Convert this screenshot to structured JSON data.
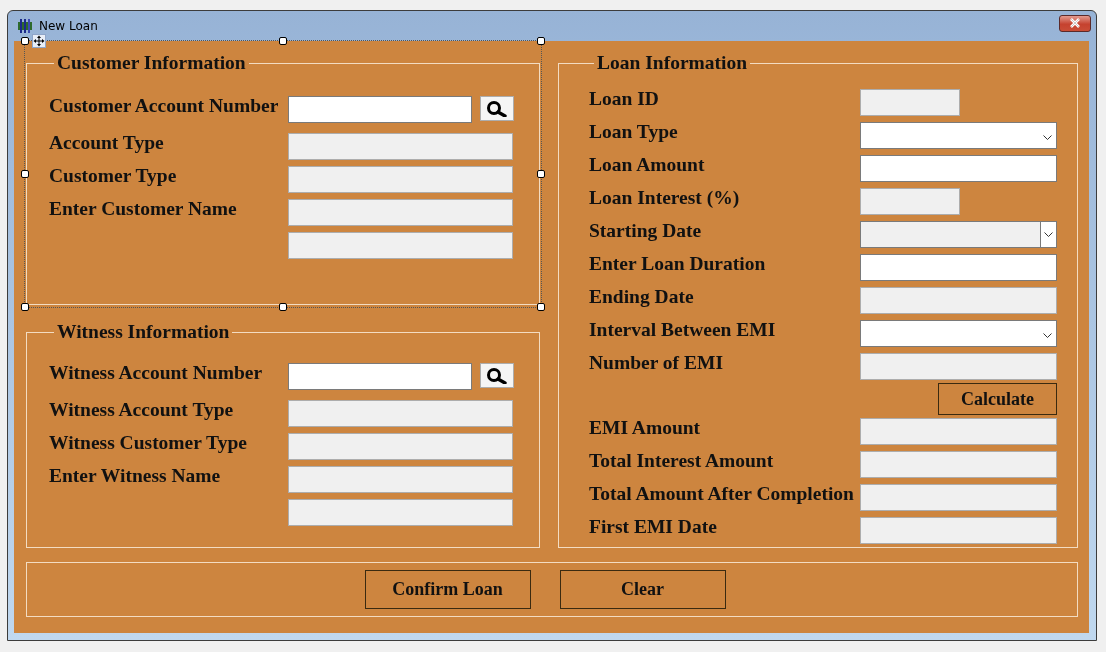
{
  "window": {
    "title": "New Loan"
  },
  "customer_information": {
    "title": "Customer Information",
    "selected": true,
    "rows": [
      {
        "label": "Customer Account Number",
        "kind": "text",
        "disabled": false,
        "search": true
      },
      {
        "label": "Account Type",
        "kind": "text",
        "disabled": true,
        "search": false
      },
      {
        "label": "Customer Type",
        "kind": "text",
        "disabled": true,
        "search": false
      },
      {
        "label": "Enter Customer Name",
        "kind": "text",
        "disabled": true,
        "search": false
      },
      {
        "kind": "text",
        "disabled": true,
        "search": false
      }
    ]
  },
  "witness_information": {
    "title": "Witness Information",
    "selected": false,
    "rows": [
      {
        "label": "Witness Account Number",
        "kind": "text",
        "disabled": false,
        "search": true
      },
      {
        "label": "Witness Account Type",
        "kind": "text",
        "disabled": true,
        "search": false
      },
      {
        "label": "Witness Customer Type",
        "kind": "text",
        "disabled": true,
        "search": false
      },
      {
        "label": "Enter Witness Name",
        "kind": "text",
        "disabled": true,
        "search": false
      },
      {
        "kind": "text",
        "disabled": true,
        "search": false
      }
    ]
  },
  "loan_information": {
    "title": "Loan Information",
    "selected": false,
    "rows": [
      {
        "label": "Loan ID",
        "kind": "short-text",
        "disabled": true
      },
      {
        "label": "Loan Type",
        "kind": "dropdown",
        "disabled": false
      },
      {
        "label": "Loan Amount",
        "kind": "text",
        "disabled": false
      },
      {
        "label": "Loan Interest (%)",
        "kind": "short-text",
        "disabled": true
      },
      {
        "label": "Starting Date",
        "kind": "dropdown",
        "disabled": true
      },
      {
        "label": "Enter Loan Duration",
        "kind": "text",
        "disabled": false
      },
      {
        "label": "Ending Date",
        "kind": "text",
        "disabled": true
      },
      {
        "label": "Interval Between EMI",
        "kind": "dropdown",
        "disabled": false
      },
      {
        "label": "Number of EMI",
        "kind": "text",
        "disabled": true
      },
      {
        "label": "Calculate",
        "kind": "button"
      },
      {
        "label": "EMI Amount",
        "kind": "text",
        "disabled": true
      },
      {
        "label": "Total Interest Amount",
        "kind": "text",
        "disabled": true
      },
      {
        "label": "Total Amount After Completion",
        "kind": "text",
        "disabled": true
      },
      {
        "label": "First EMI Date",
        "kind": "text",
        "disabled": true
      }
    ]
  },
  "actions": {
    "selected": false,
    "buttons": [
      "Confirm Loan",
      "Clear"
    ]
  }
}
